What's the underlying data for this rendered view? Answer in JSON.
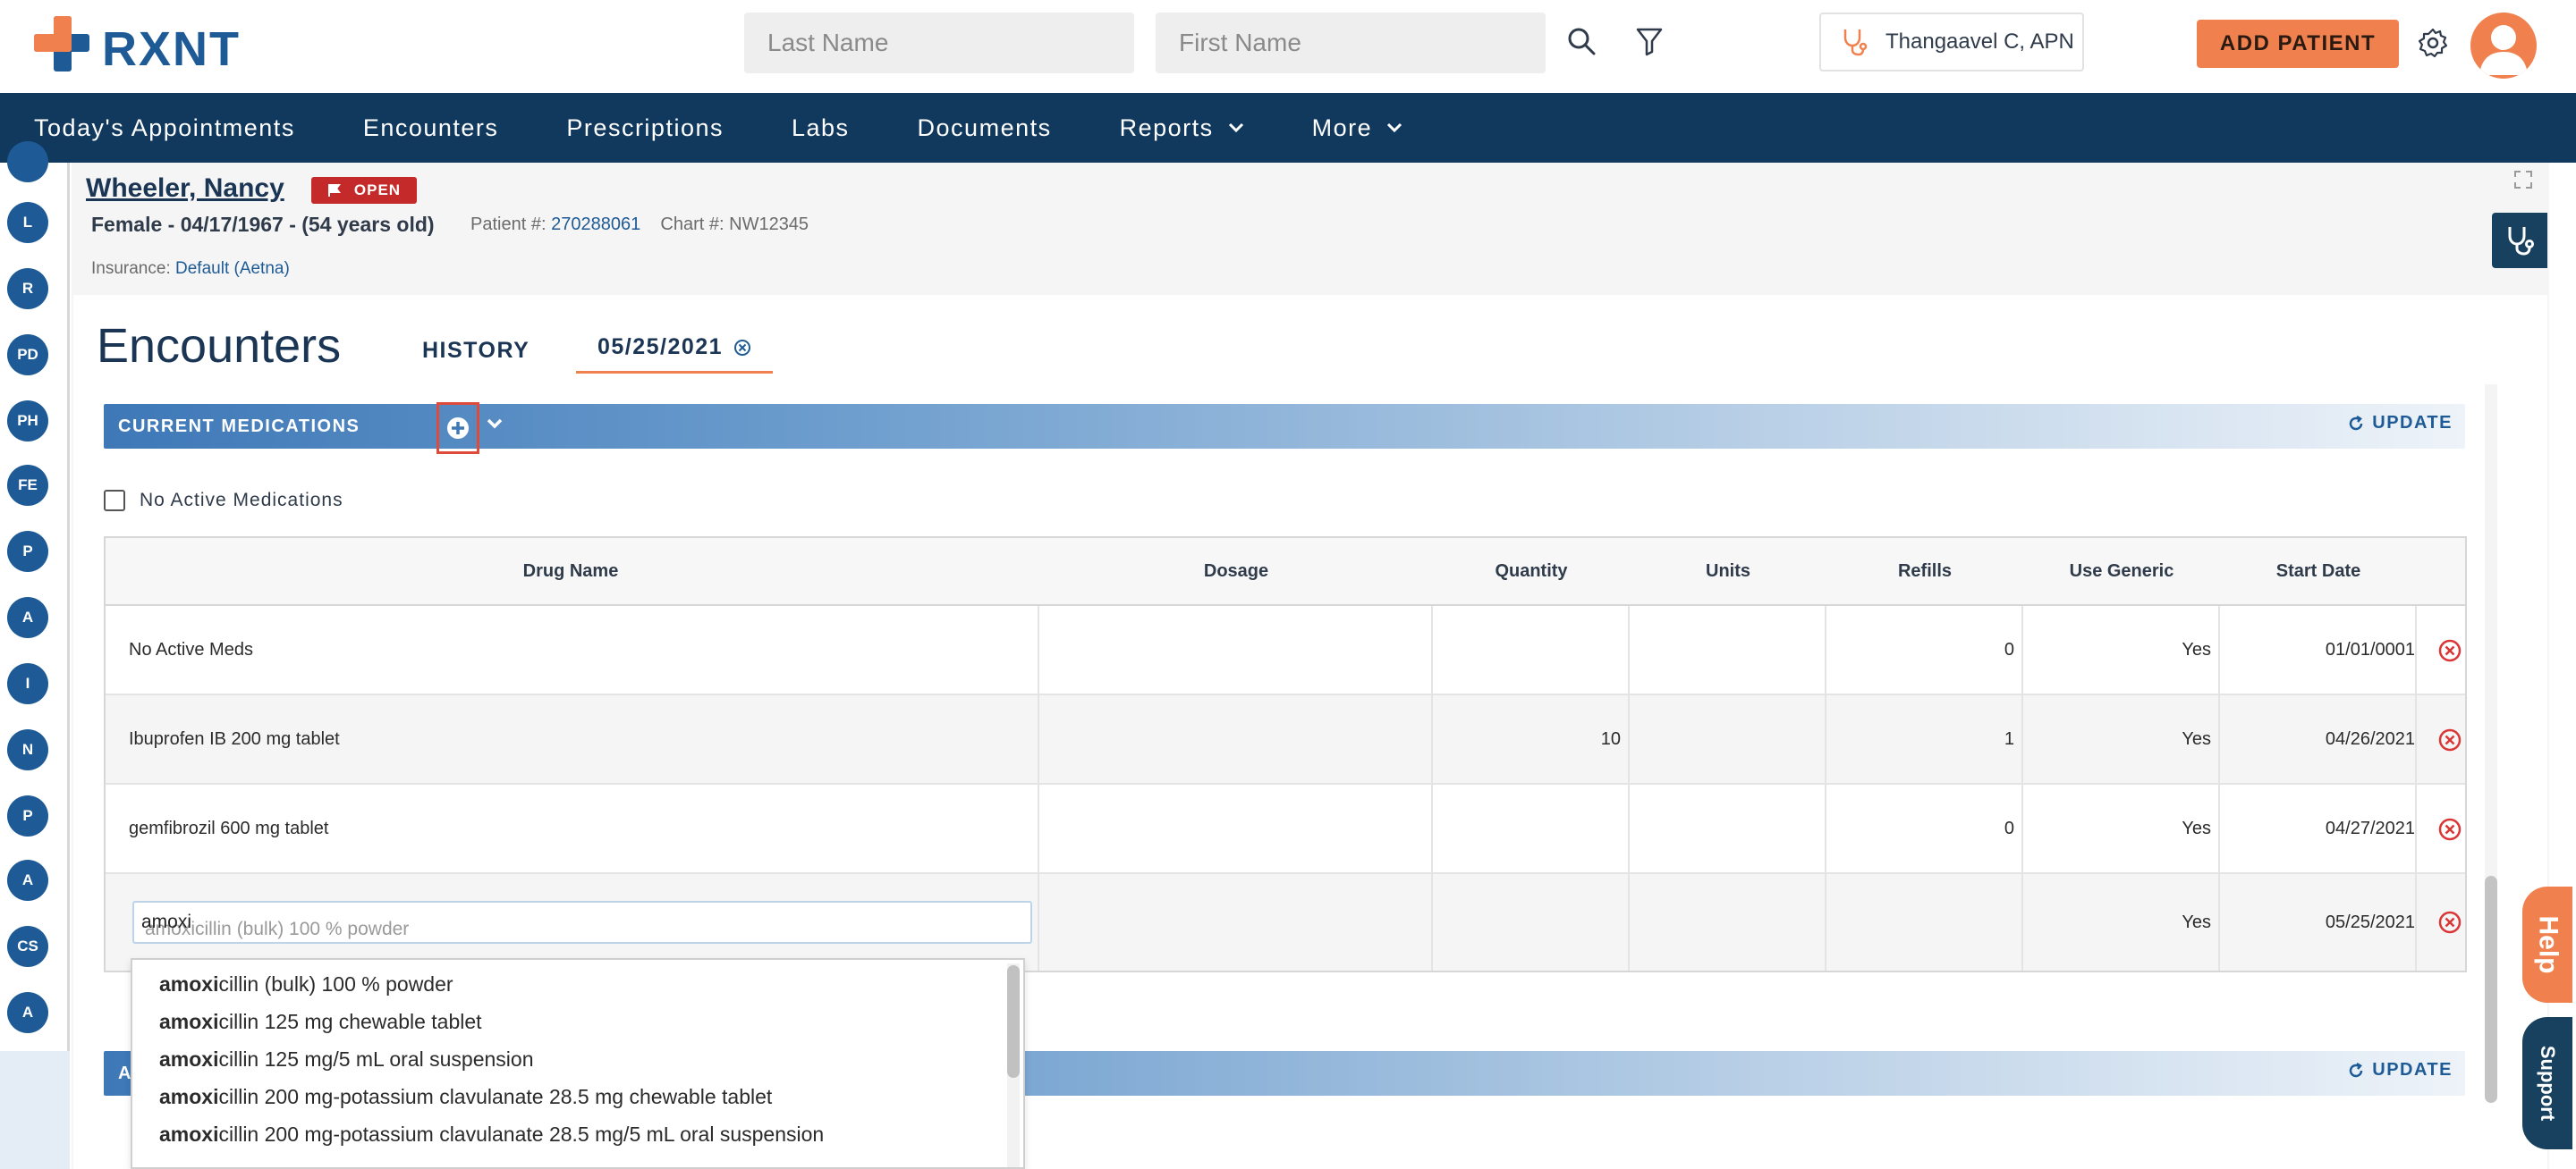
{
  "brand": {
    "name": "RXNT"
  },
  "search": {
    "last_name_placeholder": "Last Name",
    "first_name_placeholder": "First Name"
  },
  "provider": {
    "name": "Thangaavel C, APN"
  },
  "header": {
    "add_patient_label": "ADD PATIENT"
  },
  "nav": {
    "items": [
      {
        "label": "Today's Appointments"
      },
      {
        "label": "Encounters"
      },
      {
        "label": "Prescriptions"
      },
      {
        "label": "Labs"
      },
      {
        "label": "Documents"
      },
      {
        "label": "Reports"
      },
      {
        "label": "More"
      }
    ]
  },
  "sidebar": {
    "pills": [
      "L",
      "R",
      "PD",
      "PH",
      "FE",
      "P",
      "A",
      "I",
      "N",
      "P",
      "A",
      "CS",
      "A"
    ]
  },
  "patient": {
    "name": "Wheeler, Nancy ",
    "status_badge": "OPEN",
    "demographics": "Female - 04/17/1967 - (54 years old)",
    "patient_number_label": "Patient #:",
    "patient_number": "270288061",
    "chart_label": "Chart #: NW12345",
    "insurance_label": "Insurance:",
    "insurance_value": "Default (Aetna)"
  },
  "encounters": {
    "title": "Encounters",
    "tab_history": "HISTORY",
    "tab_date": "05/25/2021"
  },
  "current_medications": {
    "title": "CURRENT MEDICATIONS",
    "update_label": "UPDATE",
    "no_active_label": "No Active Medications",
    "columns": [
      "Drug Name",
      "Dosage",
      "Quantity",
      "Units",
      "Refills",
      "Use Generic",
      "Start Date"
    ],
    "rows": [
      {
        "drug": "No Active Meds",
        "dosage": "",
        "quantity": "",
        "units": "",
        "refills": "0",
        "generic": "Yes",
        "start": "01/01/0001"
      },
      {
        "drug": "Ibuprofen IB 200 mg tablet",
        "dosage": "",
        "quantity": "10",
        "units": "",
        "refills": "1",
        "generic": "Yes",
        "start": "04/26/2021"
      },
      {
        "drug": "gemfibrozil 600 mg tablet",
        "dosage": "",
        "quantity": "",
        "units": "",
        "refills": "0",
        "generic": "Yes",
        "start": "04/27/2021"
      },
      {
        "drug": "",
        "dosage": "",
        "quantity": "",
        "units": "",
        "refills": "",
        "generic": "Yes",
        "start": "05/25/2021"
      }
    ],
    "input_value": "amoxi",
    "input_suggestion": "amoxicillin (bulk) 100 % powder",
    "suggestions": [
      {
        "match": "amoxi",
        "rest": "cillin (bulk) 100 % powder"
      },
      {
        "match": "amoxi",
        "rest": "cillin 125 mg chewable tablet"
      },
      {
        "match": "amoxi",
        "rest": "cillin 125 mg/5 mL oral suspension"
      },
      {
        "match": "amoxi",
        "rest": "cillin 200 mg-potassium clavulanate 28.5 mg chewable tablet"
      },
      {
        "match": "amoxi",
        "rest": "cillin 200 mg-potassium clavulanate 28.5 mg/5 mL oral suspension"
      }
    ]
  },
  "second_section": {
    "title_initial": "A",
    "update_label": "UPDATE"
  },
  "side_tabs": {
    "help": "Help",
    "support": "Support"
  },
  "colors": {
    "navy": "#11395e",
    "brand_blue": "#1e5b96",
    "accent_orange": "#f0814f",
    "danger_red": "#c42a2a"
  }
}
